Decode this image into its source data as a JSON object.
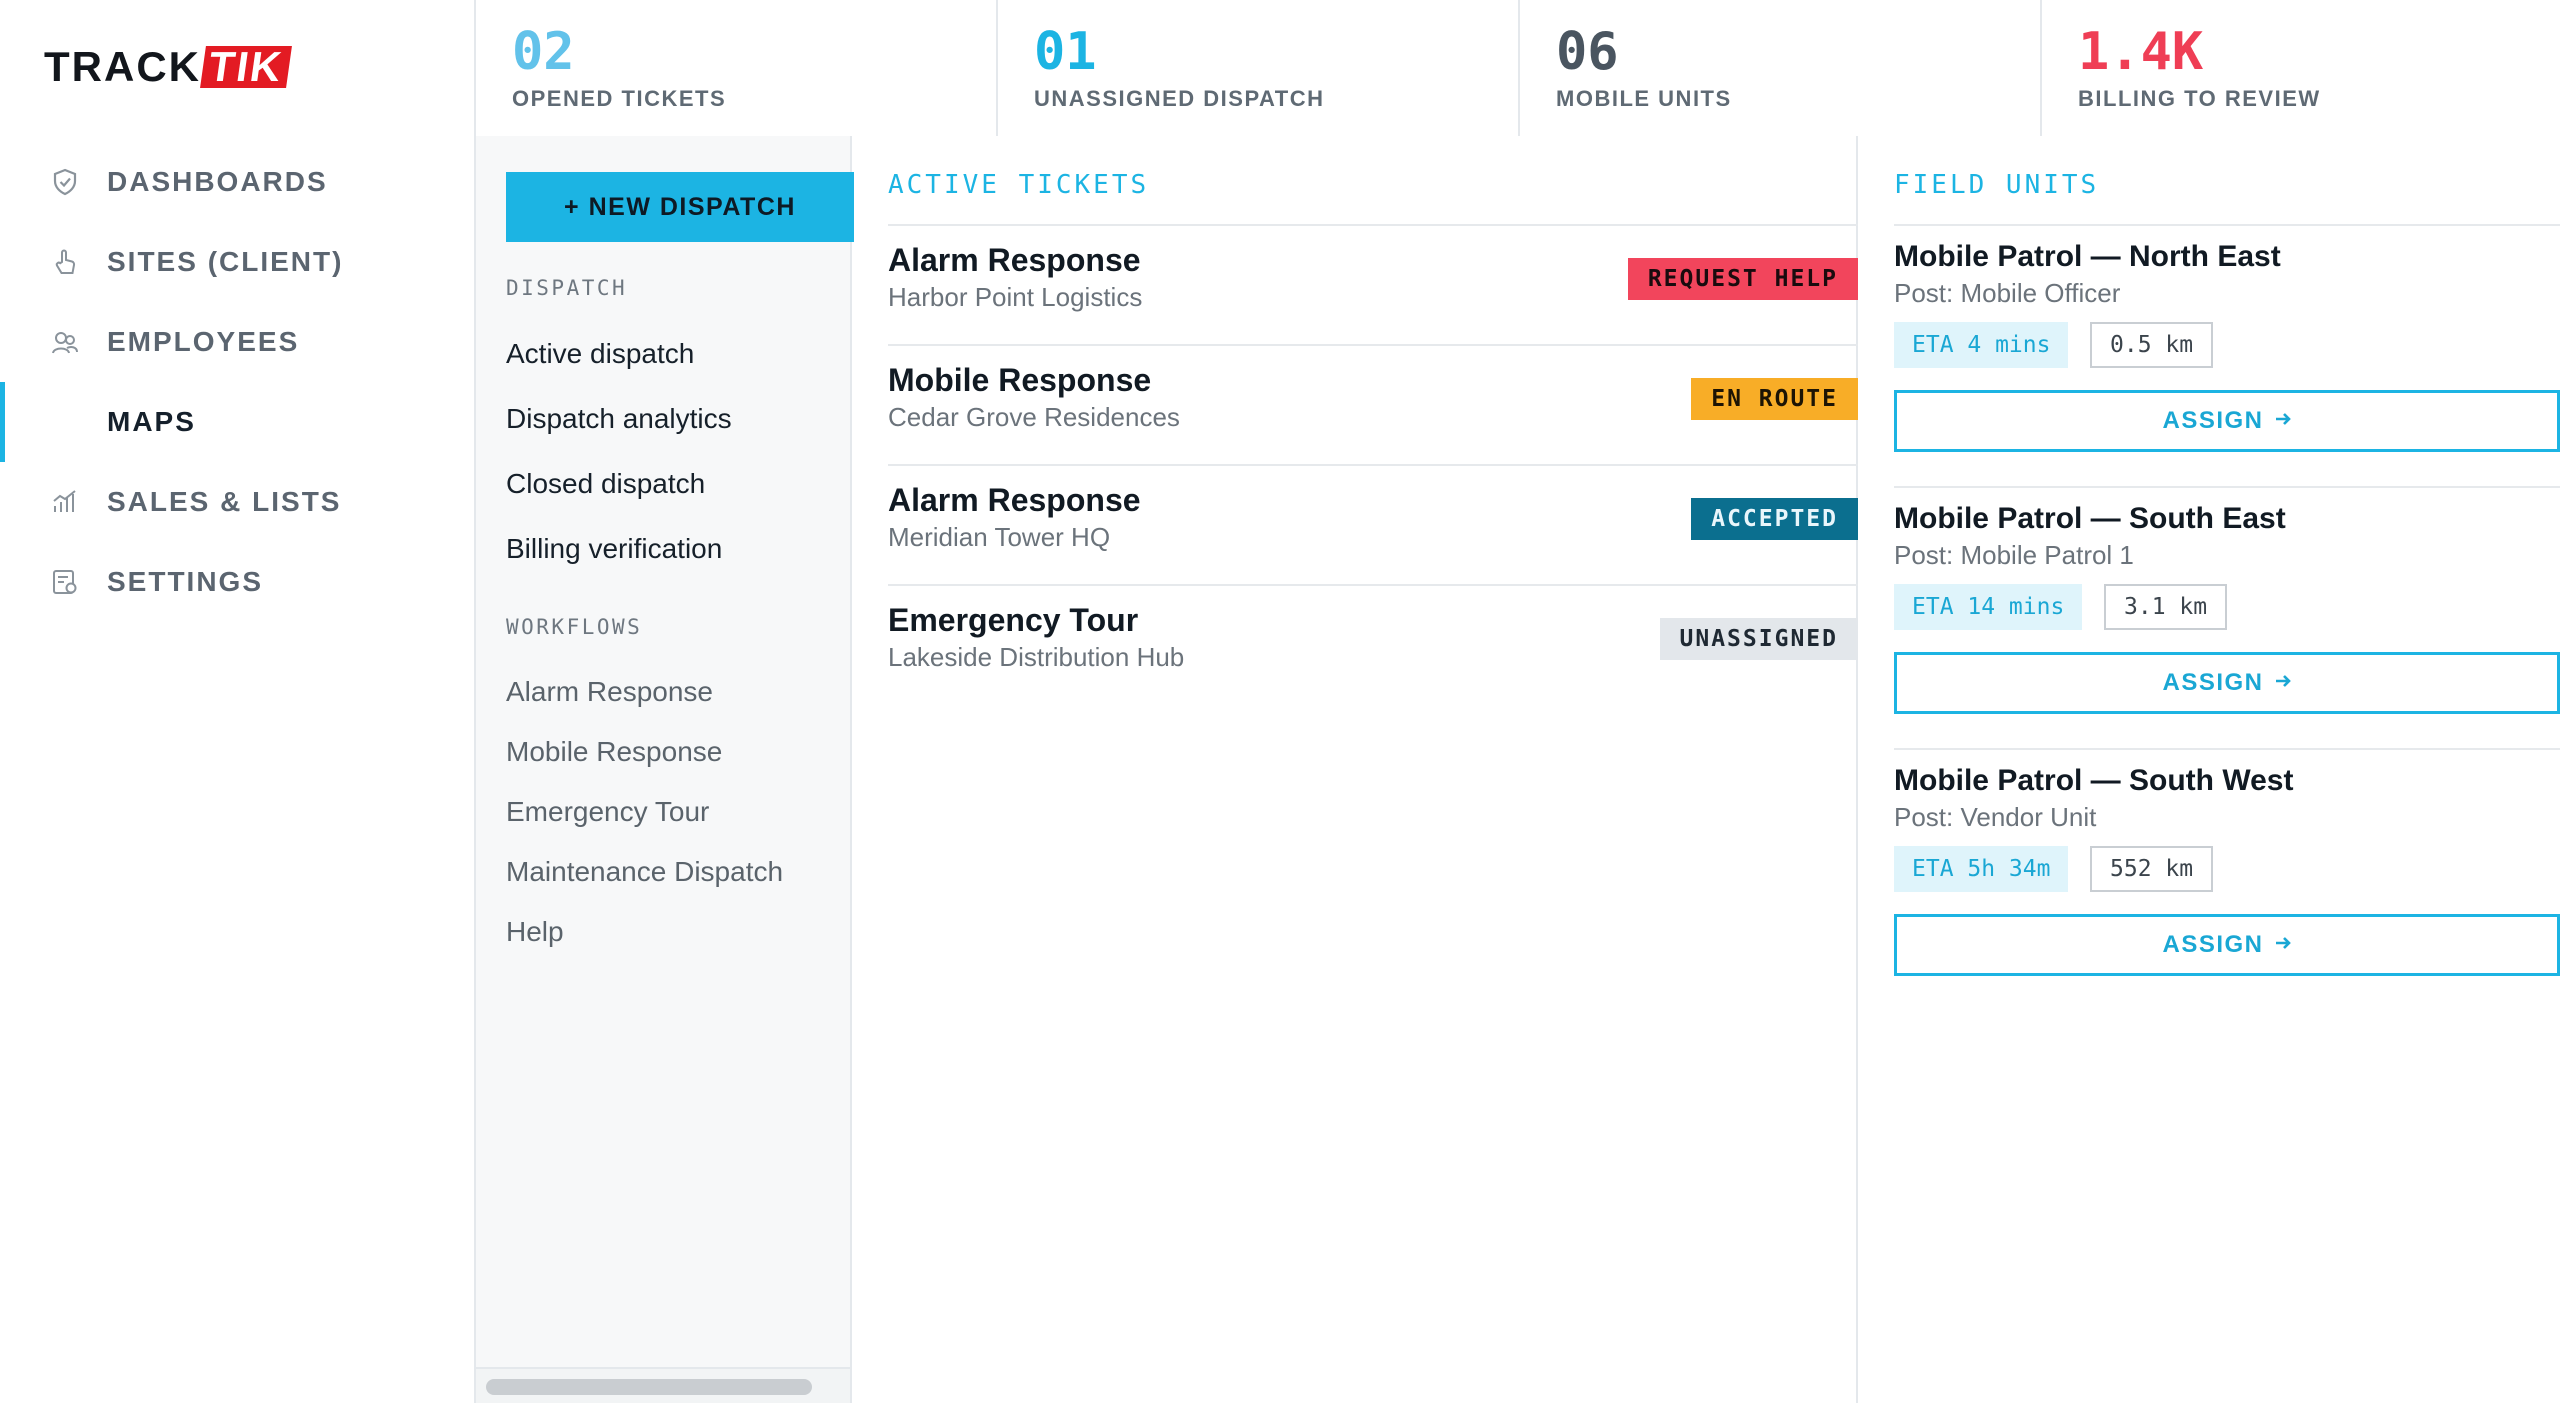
{
  "brand": {
    "part1": "TRACK",
    "part2": "TIK",
    "accent": "#e31b23"
  },
  "nav": {
    "items": [
      {
        "label": "DASHBOARDS",
        "icon": "shield-icon",
        "active": false
      },
      {
        "label": "SITES (CLIENT)",
        "icon": "hand-pointer-icon",
        "active": false
      },
      {
        "label": "EMPLOYEES",
        "icon": "users-icon",
        "active": false
      },
      {
        "label": "MAPS",
        "icon": "",
        "active": true
      },
      {
        "label": "SALES & LISTS",
        "icon": "trend-chart-icon",
        "active": false
      },
      {
        "label": "SETTINGS",
        "icon": "settings-doc-icon",
        "active": false
      }
    ]
  },
  "stats": [
    {
      "value": "02",
      "caption": "OPENED TICKETS",
      "color": "#62c2ea"
    },
    {
      "value": "01",
      "caption": "UNASSIGNED DISPATCH",
      "color": "#1cb4e3"
    },
    {
      "value": "06",
      "caption": "MOBILE UNITS",
      "color": "#4a5560"
    },
    {
      "value": "1.4K",
      "caption": "BILLING TO REVIEW",
      "color": "#ef3e55"
    }
  ],
  "menu": {
    "new_dispatch": "+ NEW DISPATCH",
    "dispatch_heading": "DISPATCH",
    "dispatch_links": [
      "Active dispatch",
      "Dispatch analytics",
      "Closed dispatch",
      "Billing verification"
    ],
    "workflows_heading": "WORKFLOWS",
    "workflow_links": [
      "Alarm Response",
      "Mobile Response",
      "Emergency Tour",
      "Maintenance Dispatch",
      "Help"
    ]
  },
  "tickets": {
    "title": "ACTIVE TICKETS",
    "items": [
      {
        "name": "Alarm Response",
        "site": "Harbor Point Logistics",
        "status": "REQUEST HELP",
        "bg": "#f2455c",
        "fg": "#1a0b0e"
      },
      {
        "name": "Mobile Response",
        "site": "Cedar Grove Residences",
        "status": "EN ROUTE",
        "bg": "#f8ad27",
        "fg": "#1d1404"
      },
      {
        "name": "Alarm Response",
        "site": "Meridian Tower HQ",
        "status": "ACCEPTED",
        "bg": "#0b6f8f",
        "fg": "#e9f6fb"
      },
      {
        "name": "Emergency Tour",
        "site": "Lakeside Distribution Hub",
        "status": "UNASSIGNED",
        "bg": "#e3e7eb",
        "fg": "#1f2933"
      }
    ]
  },
  "units": {
    "title": "FIELD UNITS",
    "items": [
      {
        "name": "Mobile Patrol — North East",
        "post": "Post: Mobile Officer",
        "eta": "ETA 4 mins",
        "distance": "0.5 km",
        "assign": "ASSIGN"
      },
      {
        "name": "Mobile Patrol — South East",
        "post": "Post: Mobile Patrol 1",
        "eta": "ETA 14 mins",
        "distance": "3.1 km",
        "assign": "ASSIGN"
      },
      {
        "name": "Mobile Patrol — South West",
        "post": "Post: Vendor Unit",
        "eta": "ETA 5h 34m",
        "distance": "552 km",
        "assign": "ASSIGN"
      }
    ]
  }
}
